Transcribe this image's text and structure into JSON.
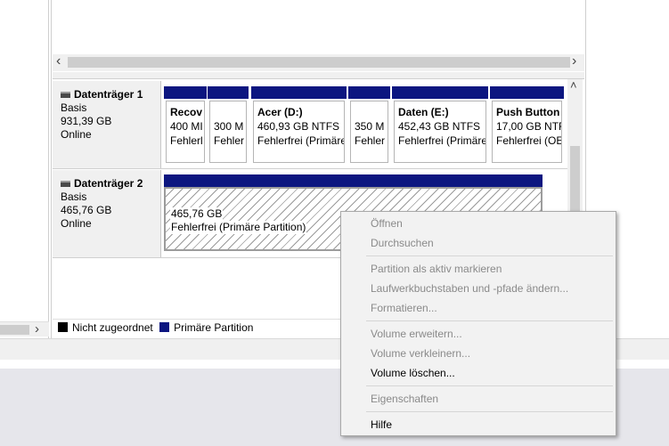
{
  "scroll": {
    "left_arrow": "‹",
    "right_arrow": "›",
    "up_arrow": "˄",
    "left_pane_arrow": "›"
  },
  "disks": [
    {
      "name": "Datenträger 1",
      "type": "Basis",
      "size": "931,39 GB",
      "status": "Online",
      "partitions": [
        {
          "name": "Recov",
          "size": "400 MI",
          "status": "Fehlerl"
        },
        {
          "name": "",
          "size": "300 M",
          "status": "Fehler"
        },
        {
          "name": "Acer  (D:)",
          "size": "460,93 GB NTFS",
          "status": "Fehlerfrei (Primäre"
        },
        {
          "name": "",
          "size": "350 M",
          "status": "Fehler"
        },
        {
          "name": "Daten  (E:)",
          "size": "452,43 GB NTFS",
          "status": "Fehlerfrei (Primäre"
        },
        {
          "name": "Push Button",
          "size": "17,00 GB NTF",
          "status": "Fehlerfrei (OE"
        }
      ]
    },
    {
      "name": "Datenträger 2",
      "type": "Basis",
      "size": "465,76 GB",
      "status": "Online",
      "partitions": [
        {
          "size": "465,76 GB",
          "status": "Fehlerfrei (Primäre Partition)"
        }
      ]
    }
  ],
  "legend": {
    "unallocated": {
      "label": "Nicht zugeordnet",
      "color": "#000000"
    },
    "primary": {
      "label": "Primäre Partition",
      "color": "#0c1680"
    }
  },
  "context_menu": {
    "items": [
      {
        "label": "Öffnen",
        "enabled": false
      },
      {
        "label": "Durchsuchen",
        "enabled": false
      },
      {
        "label": "Partition als aktiv markieren",
        "enabled": false
      },
      {
        "label": "Laufwerkbuchstaben und -pfade ändern...",
        "enabled": false
      },
      {
        "label": "Formatieren...",
        "enabled": false
      },
      {
        "label": "Volume erweitern...",
        "enabled": false
      },
      {
        "label": "Volume verkleinern...",
        "enabled": false
      },
      {
        "label": "Volume löschen...",
        "enabled": true
      },
      {
        "label": "Eigenschaften",
        "enabled": false
      },
      {
        "label": "Hilfe",
        "enabled": true
      }
    ]
  },
  "colors": {
    "partition_bar": "#0c1680",
    "menu_bg": "#f2f2f2"
  }
}
